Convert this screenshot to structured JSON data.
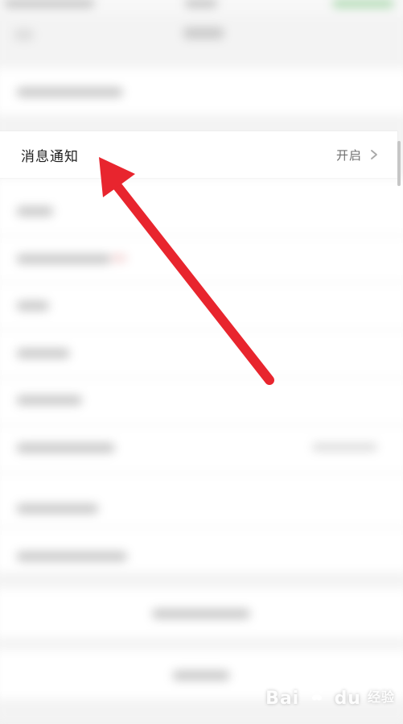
{
  "focused_item": {
    "label": "消息通知",
    "value": "开启",
    "chevron_icon": "chevron-right-icon"
  },
  "annotation": {
    "arrow_color": "#e8252e",
    "arrow_icon": "red-arrow-annotation"
  },
  "watermark": {
    "brand": "Bai",
    "brand_suffix": "du",
    "sub": "经验",
    "icon": "baidu-paw-icon"
  }
}
